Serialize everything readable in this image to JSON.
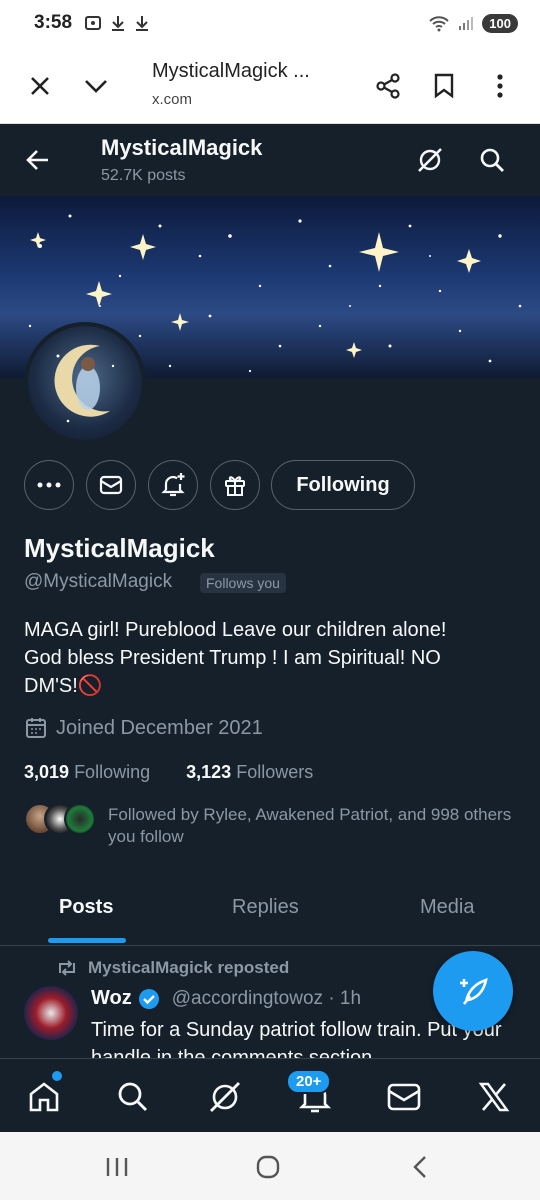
{
  "status_bar": {
    "time": "3:58",
    "battery": "100"
  },
  "browser": {
    "title": "MysticalMagick ...",
    "url": "x.com"
  },
  "header": {
    "name": "MysticalMagick",
    "posts": "52.7K posts"
  },
  "profile": {
    "following_button": "Following",
    "name": "MysticalMagick",
    "handle": "@MysticalMagick",
    "follows_you": "Follows you",
    "bio_line1": "MAGA girl! Pureblood Leave our children alone!",
    "bio_line2": "God bless President Trump !   I am Spiritual!  NO",
    "bio_line3": "DM'S!🚫",
    "joined": "Joined December 2021",
    "following_count": "3,019",
    "following_label": "Following",
    "followers_count": "3,123",
    "followers_label": "Followers",
    "followed_by": "Followed by Rylee, Awakened Patriot, and 998 others you follow"
  },
  "tabs": [
    "Posts",
    "Replies",
    "Media"
  ],
  "tweet": {
    "repost_label": "MysticalMagick reposted",
    "author": "Woz",
    "handle_time": "@accordingtowoz · 1h",
    "text": "Time for a Sunday patriot follow train.  Put your handle in the comments section"
  },
  "bottom_nav": {
    "notifications_badge": "20+"
  },
  "colors": {
    "background": "#15202b",
    "accent": "#1d9bf0",
    "secondary_text": "#8b98a5"
  }
}
